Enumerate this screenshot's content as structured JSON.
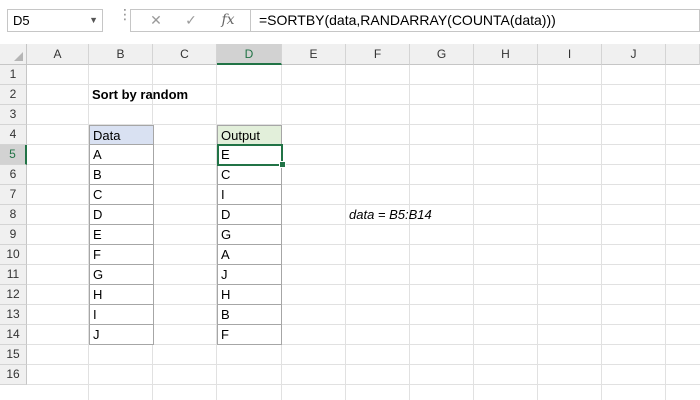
{
  "formula_bar": {
    "name_box": "D5",
    "cancel_icon": "✕",
    "enter_icon": "✓",
    "function_icon": "fx",
    "formula": "=SORTBY(data,RANDARRAY(COUNTA(data)))"
  },
  "columns": [
    "A",
    "B",
    "C",
    "D",
    "E",
    "F",
    "G",
    "H",
    "I",
    "J"
  ],
  "rows": [
    "1",
    "2",
    "3",
    "4",
    "5",
    "6",
    "7",
    "8",
    "9",
    "10",
    "11",
    "12",
    "13",
    "14",
    "15",
    "16"
  ],
  "sheet": {
    "title": "Sort by random",
    "data_header": "Data",
    "data_values": [
      "A",
      "B",
      "C",
      "D",
      "E",
      "F",
      "G",
      "H",
      "I",
      "J"
    ],
    "output_header": "Output",
    "output_values": [
      "E",
      "C",
      "I",
      "D",
      "G",
      "A",
      "J",
      "H",
      "B",
      "F"
    ],
    "named_range_note": "data = B5:B14"
  },
  "active_cell": "D5",
  "colors": {
    "accent": "#217346",
    "data_header_fill": "#d9e1f2",
    "output_header_fill": "#e2efda"
  }
}
